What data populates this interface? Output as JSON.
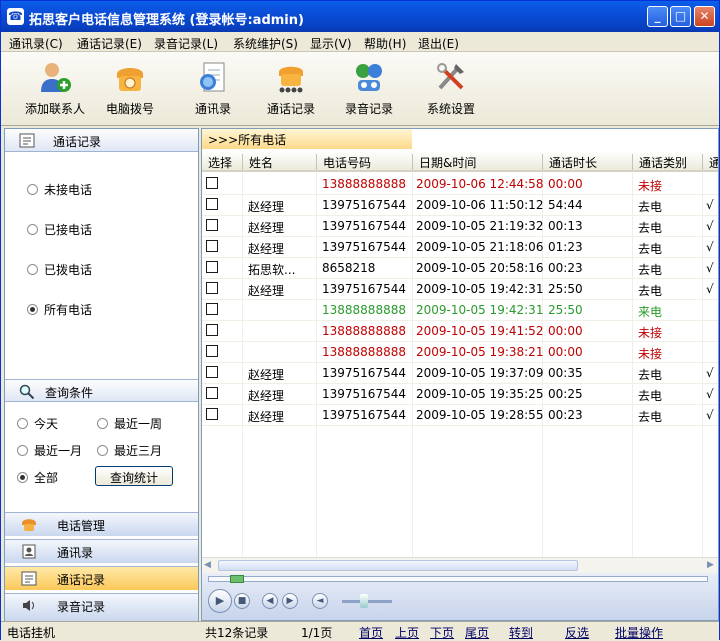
{
  "window": {
    "title": "拓思客户电话信息管理系统  (登录帐号:admin)",
    "min": "_",
    "max": "□",
    "close": "✕"
  },
  "menu": [
    "通讯录(C)",
    "通话记录(E)",
    "录音记录(L)",
    "系统维护(S)",
    "显示(V)",
    "帮助(H)",
    "退出(E)"
  ],
  "toolbar": [
    {
      "label": "添加联系人",
      "icon": "add-contact-icon"
    },
    {
      "label": "电脑拨号",
      "icon": "phone-dial-icon"
    },
    {
      "label": "通讯录",
      "icon": "address-book-icon"
    },
    {
      "label": "通话记录",
      "icon": "call-record-icon"
    },
    {
      "label": "录音记录",
      "icon": "recording-icon"
    },
    {
      "label": "系统设置",
      "icon": "settings-tools-icon"
    }
  ],
  "sidebar": {
    "section_title": "通话记录",
    "call_filters": [
      {
        "label": "未接电话",
        "selected": false
      },
      {
        "label": "已接电话",
        "selected": false
      },
      {
        "label": "已拨电话",
        "selected": false
      },
      {
        "label": "所有电话",
        "selected": true
      }
    ],
    "query_title": "查询条件",
    "periods": [
      {
        "label": "今天",
        "selected": false
      },
      {
        "label": "最近一周",
        "selected": false
      },
      {
        "label": "最近一月",
        "selected": false
      },
      {
        "label": "最近三月",
        "selected": false
      },
      {
        "label": "全部",
        "selected": true
      }
    ],
    "query_button": "查询统计",
    "nav": [
      {
        "label": "电话管理",
        "selected": false
      },
      {
        "label": "通讯录",
        "selected": false
      },
      {
        "label": "通话记录",
        "selected": true
      },
      {
        "label": "录音记录",
        "selected": false
      }
    ]
  },
  "main": {
    "breadcrumb": ">>>所有电话",
    "columns": [
      "选择",
      "姓名",
      "电话号码",
      "日期&时间",
      "通话时长",
      "通话类别",
      "通"
    ],
    "rows": [
      {
        "name": "",
        "phone": "13888888888",
        "datetime": "2009-10-06 12:44:58",
        "duration": "00:00",
        "type": "未接",
        "extra": "",
        "color": "#c00000"
      },
      {
        "name": "赵经理",
        "phone": "13975167544",
        "datetime": "2009-10-06 11:50:12",
        "duration": "54:44",
        "type": "去电",
        "extra": "√",
        "color": "#000000"
      },
      {
        "name": "赵经理",
        "phone": "13975167544",
        "datetime": "2009-10-05 21:19:32",
        "duration": "00:13",
        "type": "去电",
        "extra": "√",
        "color": "#000000"
      },
      {
        "name": "赵经理",
        "phone": "13975167544",
        "datetime": "2009-10-05 21:18:06",
        "duration": "01:23",
        "type": "去电",
        "extra": "√",
        "color": "#000000"
      },
      {
        "name": "拓思软...",
        "phone": "8658218",
        "datetime": "2009-10-05 20:58:16",
        "duration": "00:23",
        "type": "去电",
        "extra": "√",
        "color": "#000000"
      },
      {
        "name": "赵经理",
        "phone": "13975167544",
        "datetime": "2009-10-05 19:42:31",
        "duration": "25:50",
        "type": "去电",
        "extra": "√",
        "color": "#000000"
      },
      {
        "name": "",
        "phone": "13888888888",
        "datetime": "2009-10-05 19:42:31",
        "duration": "25:50",
        "type": "来电",
        "extra": "",
        "color": "#2a9a2a"
      },
      {
        "name": "",
        "phone": "13888888888",
        "datetime": "2009-10-05 19:41:52",
        "duration": "00:00",
        "type": "未接",
        "extra": "",
        "color": "#c00000"
      },
      {
        "name": "",
        "phone": "13888888888",
        "datetime": "2009-10-05 19:38:21",
        "duration": "00:00",
        "type": "未接",
        "extra": "",
        "color": "#c00000"
      },
      {
        "name": "赵经理",
        "phone": "13975167544",
        "datetime": "2009-10-05 19:37:09",
        "duration": "00:35",
        "type": "去电",
        "extra": "√",
        "color": "#000000"
      },
      {
        "name": "赵经理",
        "phone": "13975167544",
        "datetime": "2009-10-05 19:35:25",
        "duration": "00:25",
        "type": "去电",
        "extra": "√",
        "color": "#000000"
      },
      {
        "name": "赵经理",
        "phone": "13975167544",
        "datetime": "2009-10-05 19:28:55",
        "duration": "00:23",
        "type": "去电",
        "extra": "√",
        "color": "#000000"
      }
    ]
  },
  "status": {
    "left": "电话挂机",
    "total": "共12条记录",
    "page": "1/1页",
    "first": "首页",
    "prev": "上页",
    "next": "下页",
    "last": "尾页",
    "goto": "转到",
    "invert": "反选",
    "batch": "批量操作"
  }
}
